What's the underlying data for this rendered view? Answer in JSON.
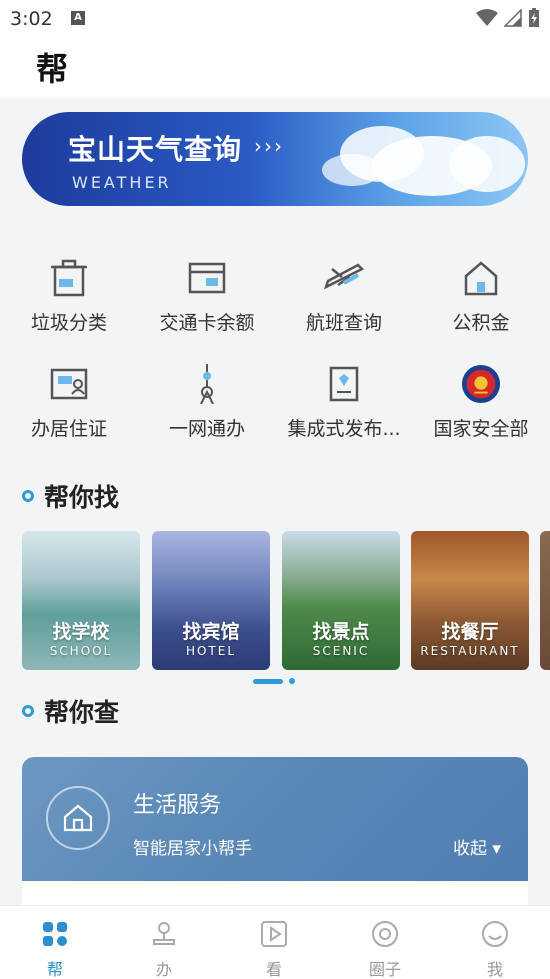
{
  "status_bar": {
    "time": "3:02",
    "notification_letter": "A"
  },
  "header": {
    "title": "帮"
  },
  "banner": {
    "title": "宝山天气查询",
    "arrows": "›››",
    "subtitle": "WEATHER"
  },
  "services": [
    {
      "label": "垃圾分类",
      "icon": "trash-bin-icon"
    },
    {
      "label": "交通卡余额",
      "icon": "transit-card-icon"
    },
    {
      "label": "航班查询",
      "icon": "airplane-icon"
    },
    {
      "label": "公积金",
      "icon": "house-fund-icon"
    },
    {
      "label": "办居住证",
      "icon": "id-card-icon"
    },
    {
      "label": "一网通办",
      "icon": "tv-tower-icon"
    },
    {
      "label": "集成式发布...",
      "icon": "document-icon"
    },
    {
      "label": "国家安全部",
      "icon": "national-emblem-icon"
    }
  ],
  "section_find": {
    "title": "帮你找"
  },
  "cards": [
    {
      "title": "找学校",
      "subtitle": "SCHOOL"
    },
    {
      "title": "找宾馆",
      "subtitle": "HOTEL"
    },
    {
      "title": "找景点",
      "subtitle": "SCENIC"
    },
    {
      "title": "找餐厅",
      "subtitle": "RESTAURANT"
    }
  ],
  "section_check": {
    "title": "帮你查"
  },
  "life_service": {
    "title": "生活服务",
    "subtitle": "智能居家小帮手",
    "collapse_label": "收起 ▾"
  },
  "bottom_nav": [
    {
      "label": "帮",
      "icon": "grid-icon",
      "active": true
    },
    {
      "label": "办",
      "icon": "stamp-icon",
      "active": false
    },
    {
      "label": "看",
      "icon": "play-icon",
      "active": false
    },
    {
      "label": "圈子",
      "icon": "circle-icon",
      "active": false
    },
    {
      "label": "我",
      "icon": "smile-icon",
      "active": false
    }
  ],
  "colors": {
    "accent": "#2f9bd6",
    "nav_active": "#2d8fd0"
  }
}
